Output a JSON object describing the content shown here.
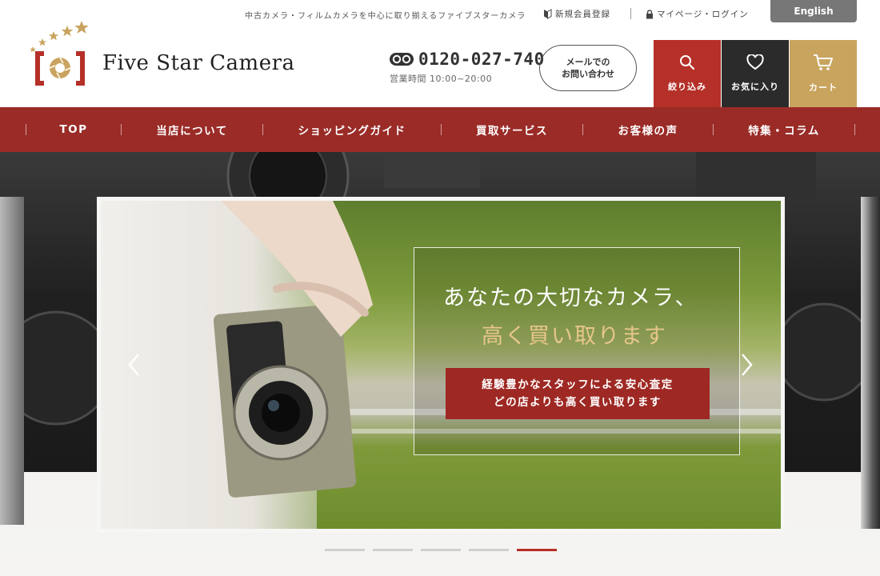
{
  "utility": {
    "tagline": "中古カメラ・フィルムカメラを中心に取り揃えるファイブスターカメラ",
    "register_label": "新規会員登録",
    "mypage_label": "マイページ・ログイン",
    "english_label": "English"
  },
  "header": {
    "logo_name": "Five Star Camera",
    "phone_number": "0120-027-740",
    "business_hours": "営業時間 10:00~20:00",
    "mail_line1": "メールでの",
    "mail_line2": "お問い合わせ",
    "search_label": "絞り込み",
    "favorites_label": "お気に入り",
    "cart_label": "カート"
  },
  "nav": {
    "items": [
      {
        "label": "TOP"
      },
      {
        "label": "当店について"
      },
      {
        "label": "ショッピングガイド"
      },
      {
        "label": "買取サービス"
      },
      {
        "label": "お客様の声"
      },
      {
        "label": "特集・コラム"
      }
    ]
  },
  "hero": {
    "headline_line1": "あなたの大切なカメラ、",
    "headline_line2": "高く買い取ります",
    "badge_line1": "経験豊かなスタッフによる安心査定",
    "badge_line2": "どの店よりも高く買い取ります",
    "slide_count": 5,
    "active_slide": 5
  },
  "colors": {
    "brand_red": "#9a2b27",
    "accent_red": "#b53028",
    "gold": "#c9a45e",
    "dark": "#2b2b2b"
  }
}
